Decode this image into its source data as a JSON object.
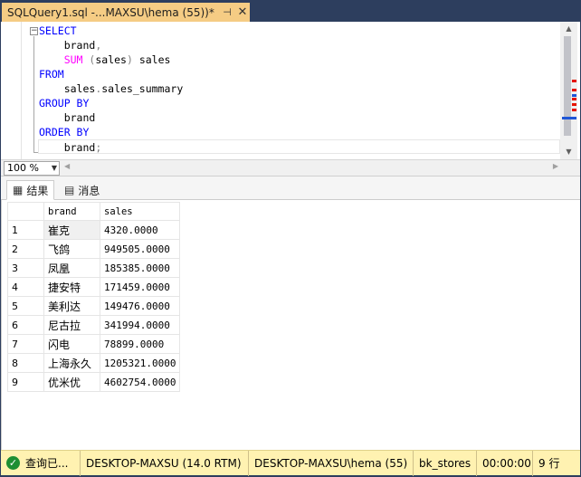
{
  "tab": {
    "title": "SQLQuery1.sql -...MAXSU\\hema (55))*",
    "pin_icon": "pin-icon",
    "close_icon": "close-icon"
  },
  "editor": {
    "lines": [
      [
        {
          "t": "SELECT",
          "c": "kw"
        }
      ],
      [
        {
          "t": "    brand",
          "c": ""
        },
        {
          "t": ",",
          "c": "gy"
        }
      ],
      [
        {
          "t": "    ",
          "c": ""
        },
        {
          "t": "SUM",
          "c": "fn"
        },
        {
          "t": " (",
          "c": "gy"
        },
        {
          "t": "sales",
          "c": ""
        },
        {
          "t": ")",
          "c": "gy"
        },
        {
          "t": " sales",
          "c": ""
        }
      ],
      [
        {
          "t": "FROM",
          "c": "kw"
        }
      ],
      [
        {
          "t": "    sales",
          "c": ""
        },
        {
          "t": ".",
          "c": "gy"
        },
        {
          "t": "sales_summary",
          "c": ""
        }
      ],
      [
        {
          "t": "GROUP BY",
          "c": "kw"
        }
      ],
      [
        {
          "t": "    brand",
          "c": ""
        }
      ],
      [
        {
          "t": "ORDER BY",
          "c": "kw"
        }
      ],
      [
        {
          "t": "    brand",
          "c": ""
        },
        {
          "t": ";",
          "c": "gy"
        }
      ]
    ],
    "colors": {
      "keyword": "#0000ff",
      "function": "#ff00ff",
      "punct": "#808080"
    }
  },
  "zoom": {
    "value": "100 %"
  },
  "results_tabs": [
    {
      "label": "结果",
      "icon": "grid-icon",
      "active": true
    },
    {
      "label": "消息",
      "icon": "messages-icon",
      "active": false
    }
  ],
  "grid": {
    "columns": [
      "brand",
      "sales"
    ],
    "rows": [
      {
        "num": "1",
        "brand": "崔克",
        "sales": "4320.0000"
      },
      {
        "num": "2",
        "brand": "飞鸽",
        "sales": "949505.0000"
      },
      {
        "num": "3",
        "brand": "凤凰",
        "sales": "185385.0000"
      },
      {
        "num": "4",
        "brand": "捷安特",
        "sales": "171459.0000"
      },
      {
        "num": "5",
        "brand": "美利达",
        "sales": "149476.0000"
      },
      {
        "num": "6",
        "brand": "尼古拉",
        "sales": "341994.0000"
      },
      {
        "num": "7",
        "brand": "闪电",
        "sales": "78899.0000"
      },
      {
        "num": "8",
        "brand": "上海永久",
        "sales": "1205321.0000"
      },
      {
        "num": "9",
        "brand": "优米优",
        "sales": "4602754.0000"
      }
    ]
  },
  "status": {
    "query_state": "查询已...",
    "server": "DESKTOP-MAXSU (14.0 RTM)",
    "user": "DESKTOP-MAXSU\\hema (55)",
    "database": "bk_stores",
    "elapsed": "00:00:00",
    "rows": "9 行",
    "color": "#fff2b1"
  }
}
